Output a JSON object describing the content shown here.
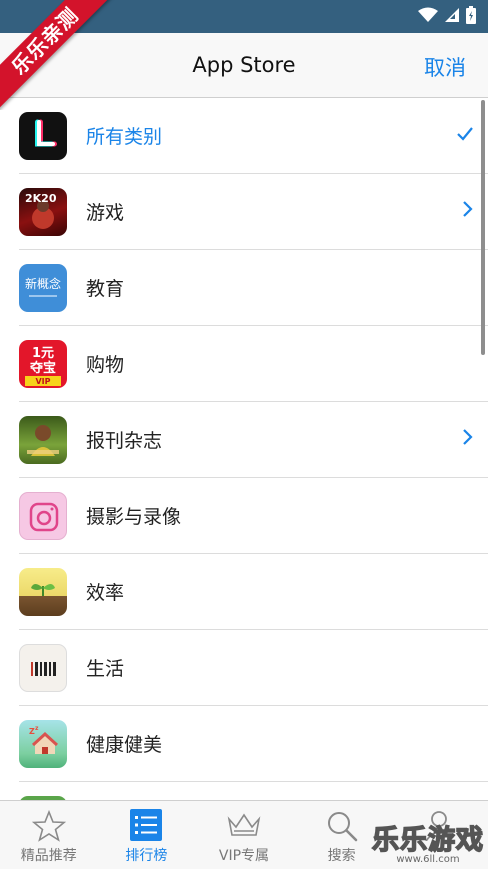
{
  "ribbon": {
    "text": "乐乐亲测"
  },
  "nav": {
    "title": "App Store",
    "cancel_label": "取消"
  },
  "categories": [
    {
      "label": "所有类别",
      "selected": true,
      "accessory": "checkmark-icon"
    },
    {
      "label": "游戏",
      "selected": false,
      "accessory": "chevron-right-icon"
    },
    {
      "label": "教育",
      "selected": false,
      "accessory": ""
    },
    {
      "label": "购物",
      "selected": false,
      "accessory": ""
    },
    {
      "label": "报刊杂志",
      "selected": false,
      "accessory": "chevron-right-icon"
    },
    {
      "label": "摄影与录像",
      "selected": false,
      "accessory": ""
    },
    {
      "label": "效率",
      "selected": false,
      "accessory": ""
    },
    {
      "label": "生活",
      "selected": false,
      "accessory": ""
    },
    {
      "label": "健康健美",
      "selected": false,
      "accessory": ""
    }
  ],
  "app_icon_text": {
    "games": "2K20",
    "education": "新概念",
    "shopping_top": "1元",
    "shopping_mid": "夺宝",
    "shopping_badge": "VIP"
  },
  "tabs": [
    {
      "label": "精品推荐",
      "icon": "star-icon",
      "active": false
    },
    {
      "label": "排行榜",
      "icon": "list-icon",
      "active": true
    },
    {
      "label": "VIP专属",
      "icon": "crown-icon",
      "active": false
    },
    {
      "label": "搜索",
      "icon": "search-icon",
      "active": false
    },
    {
      "label": "",
      "icon": "person-icon",
      "active": false
    }
  ],
  "watermark": {
    "main": "乐乐游戏",
    "sub": "www.6ll.com"
  },
  "colors": {
    "accent": "#1a84e8",
    "status_bar": "#34607f",
    "ribbon": "#d3132b"
  }
}
